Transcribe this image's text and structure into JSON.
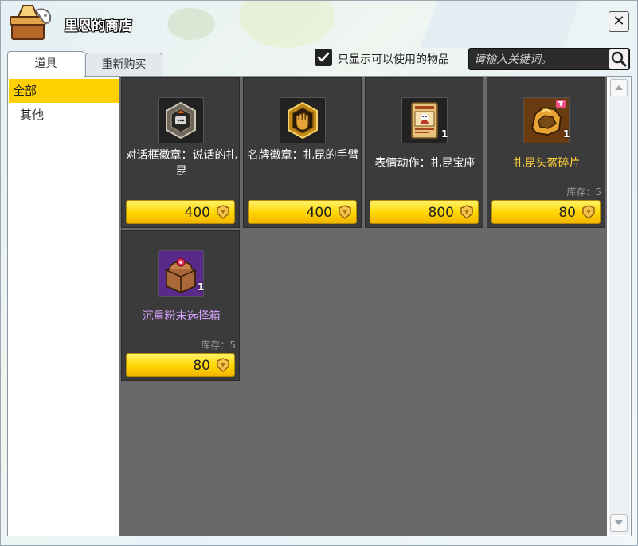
{
  "window": {
    "title": "里恩的商店"
  },
  "tabs": [
    {
      "label": "道具",
      "active": true
    },
    {
      "label": "重新购买",
      "active": false
    }
  ],
  "filter": {
    "label": "只显示可以使用的物品",
    "checked": true
  },
  "search": {
    "placeholder": "请输入关键词。"
  },
  "categories": [
    {
      "label": "全部",
      "selected": true
    },
    {
      "label": "其他",
      "selected": false
    }
  ],
  "items": [
    {
      "name": "对话框徽章：说话的扎昆",
      "price": "400",
      "icon": "chat-badge-icon",
      "name_color": "white",
      "qty": "",
      "stock": ""
    },
    {
      "name": "名牌徽章：扎昆的手臂",
      "price": "400",
      "icon": "nametag-badge-icon",
      "name_color": "white",
      "qty": "",
      "stock": ""
    },
    {
      "name": "表情动作：扎昆宝座",
      "price": "800",
      "icon": "emote-card-icon",
      "name_color": "white",
      "qty": "1",
      "stock": ""
    },
    {
      "name": "扎昆头盔碎片",
      "price": "80",
      "icon": "helmet-fragment-icon",
      "name_color": "gold",
      "qty": "1",
      "stock": "库存：5"
    },
    {
      "name": "沉重粉末选择箱",
      "price": "80",
      "icon": "powder-box-icon",
      "name_color": "purple",
      "qty": "1",
      "stock": "库存：5"
    }
  ],
  "colors": {
    "accent": "#ffd000",
    "panel": "#3b3b3b",
    "grid_bg": "#696969"
  }
}
